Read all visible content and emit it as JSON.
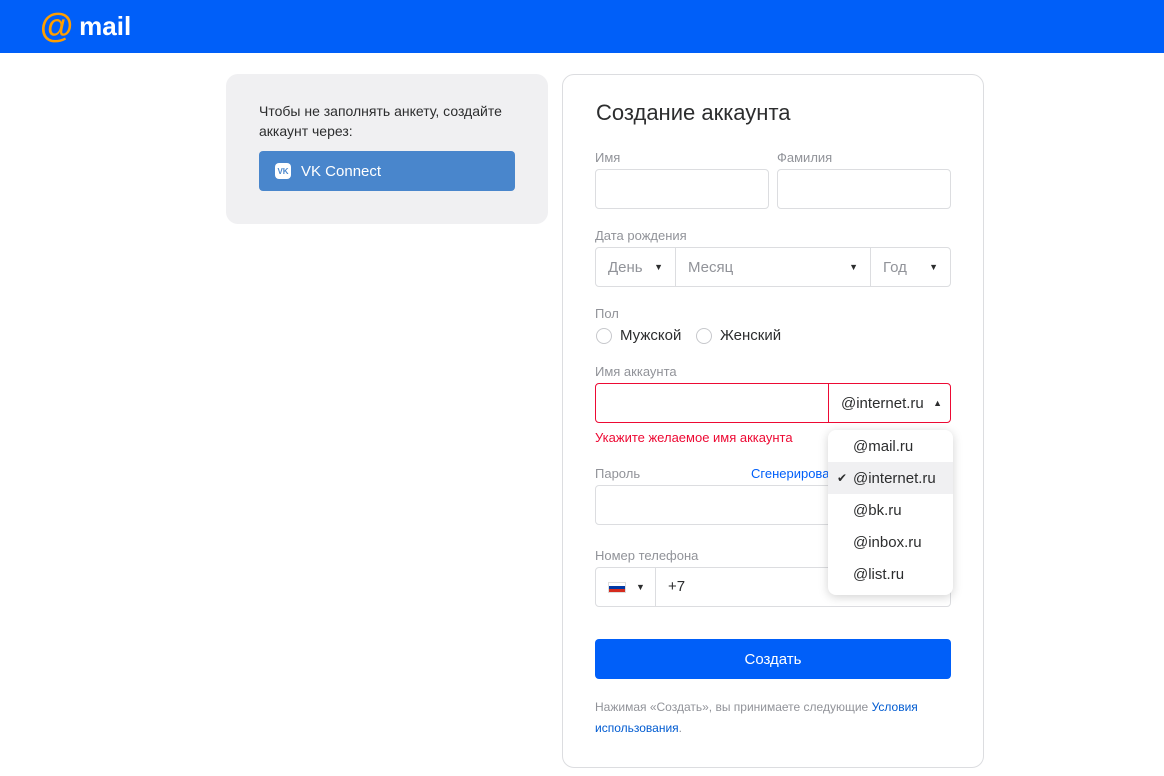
{
  "header": {
    "logo_at": "@",
    "logo_text": "mail",
    "brand_color": "#005ff9"
  },
  "left": {
    "text": "Чтобы не заполнять анкету, создайте аккаунт через:",
    "vk_label": "VK Connect",
    "vk_icon": "vk-icon"
  },
  "form": {
    "title": "Создание аккаунта",
    "first_name_label": "Имя",
    "last_name_label": "Фамилия",
    "birth_label": "Дата рождения",
    "day": "День",
    "month": "Месяц",
    "year": "Год",
    "gender_label": "Пол",
    "male": "Мужской",
    "female": "Женский",
    "account_label": "Имя аккаунта",
    "domain": "@internet.ru",
    "error": "Укажите желаемое имя аккаунта",
    "password_label": "Пароль",
    "generate": "Сгенерирова",
    "phone_label": "Номер телефона",
    "phone_prefix": "+7",
    "submit": "Создать",
    "terms_text": "Нажимая «Создать», вы принимаете следующие ",
    "terms_link": "Условия использования",
    "terms_end": "."
  },
  "domain_menu": {
    "items": [
      "@mail.ru",
      "@internet.ru",
      "@bk.ru",
      "@inbox.ru",
      "@list.ru"
    ],
    "selected": "@internet.ru"
  }
}
